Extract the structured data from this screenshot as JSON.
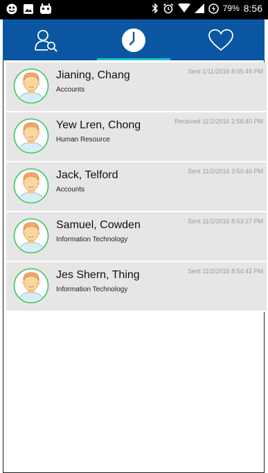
{
  "status_bar": {
    "battery_percent": "79%",
    "time": "8:56"
  },
  "tabs": [
    {
      "icon": "contact-search-icon",
      "active": false
    },
    {
      "icon": "clock-icon",
      "active": true
    },
    {
      "icon": "heart-icon",
      "active": false
    }
  ],
  "colors": {
    "tabbar": "#0b56a3",
    "indicator": "#23c2c2",
    "row_bg": "#e6e6e6",
    "avatar_ring": "#3cc45c"
  },
  "contacts": [
    {
      "name": "Jianing, Chang",
      "department": "Accounts",
      "stamp": "Sent 1/11/2016 8:05:49 PM"
    },
    {
      "name": "Yew Lren, Chong",
      "department": "Human Resource",
      "stamp": "Received 11/2/2016 2:58:40 PM"
    },
    {
      "name": "Jack, Telford",
      "department": "Accounts",
      "stamp": "Sent 11/2/2016 3:50:46 PM"
    },
    {
      "name": "Samuel, Cowden",
      "department": "Information Technology",
      "stamp": "Sent 11/2/2016 8:53:27 PM"
    },
    {
      "name": "Jes Shern, Thing",
      "department": "Information Technology",
      "stamp": "Sent 11/2/2016 8:54:42 PM"
    }
  ]
}
